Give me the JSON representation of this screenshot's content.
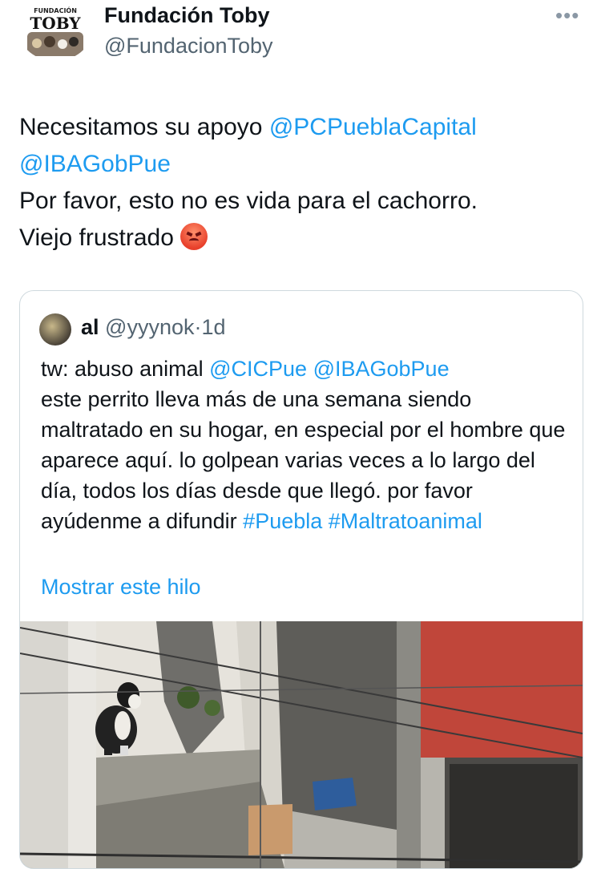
{
  "author": {
    "display_name": "Fundación Toby",
    "handle": "@FundacionToby",
    "avatar_logo_text": "FUNDACIÓN TOBY",
    "more_icon": "ellipsis-icon"
  },
  "tweet": {
    "line1_text": "Necesitamos su apoyo ",
    "mention1": "@PCPueblaCapital",
    "mention2": "@IBAGobPue",
    "line3": "Por favor, esto no es vida para el cachorro.",
    "line4": "Viejo frustrado",
    "emoji": "angry-face-emoji"
  },
  "quoted": {
    "name": "al",
    "handle": "@yyynok",
    "separator": "·",
    "time": "1d",
    "text": "tw: abuso animal @CICPue @IBAGobPue\neste perrito lleva más de una semana siendo maltratado en su hogar, en especial por el hombre que aparece aquí. lo golpean varias veces a lo largo del día, todos los días desde que llegó. por favor ayúdenme a difundir #Puebla #Maltratoanimal",
    "show_thread": "Mostrar este hilo",
    "media": "photo-dog-on-rooftop"
  },
  "colors": {
    "link": "#1d9bf0",
    "secondary_text": "#536471",
    "border": "#cfd9de"
  }
}
